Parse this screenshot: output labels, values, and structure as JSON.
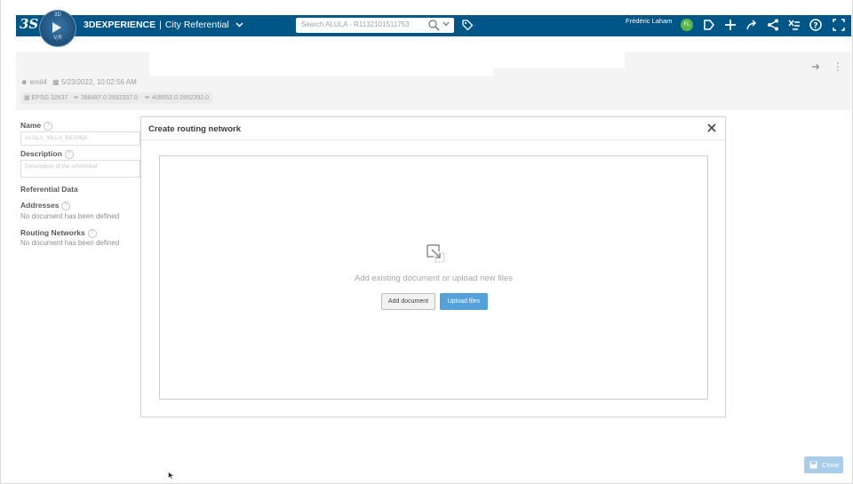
{
  "topbar": {
    "brand": "3DEXPERIENCE",
    "separator": "|",
    "app_name": "City Referential",
    "search_placeholder": "Search ALULA - R1132101511753",
    "user_name": "Frédéric Laham",
    "user_initials": "FL",
    "compass_labels": {
      "top": "3D",
      "right": "V",
      "left": "3D",
      "bottom": "V,R"
    },
    "brand_color": "#005686"
  },
  "record": {
    "owner": "emil4",
    "date": "5/23/2022, 10:02:56 AM",
    "chips": [
      "EPSG 32637",
      "388497.0 2932337.0",
      "408552.0 2952392.0"
    ]
  },
  "form": {
    "name_label": "Name",
    "name_value": "ALULA_VILLA_REGINA",
    "description_label": "Description",
    "description_placeholder": "Description of the referential",
    "referential_data_label": "Referential Data",
    "addresses_label": "Addresses",
    "addresses_empty": "No document has been defined",
    "routing_label": "Routing Networks",
    "routing_empty": "No document has been defined"
  },
  "modal": {
    "title": "Create routing network",
    "dropzone_text": "Add existing document or upload new files",
    "add_document_label": "Add document",
    "upload_files_label": "Upload files",
    "upload_color": "#54a0d8"
  },
  "footer": {
    "close_label": "Close"
  }
}
